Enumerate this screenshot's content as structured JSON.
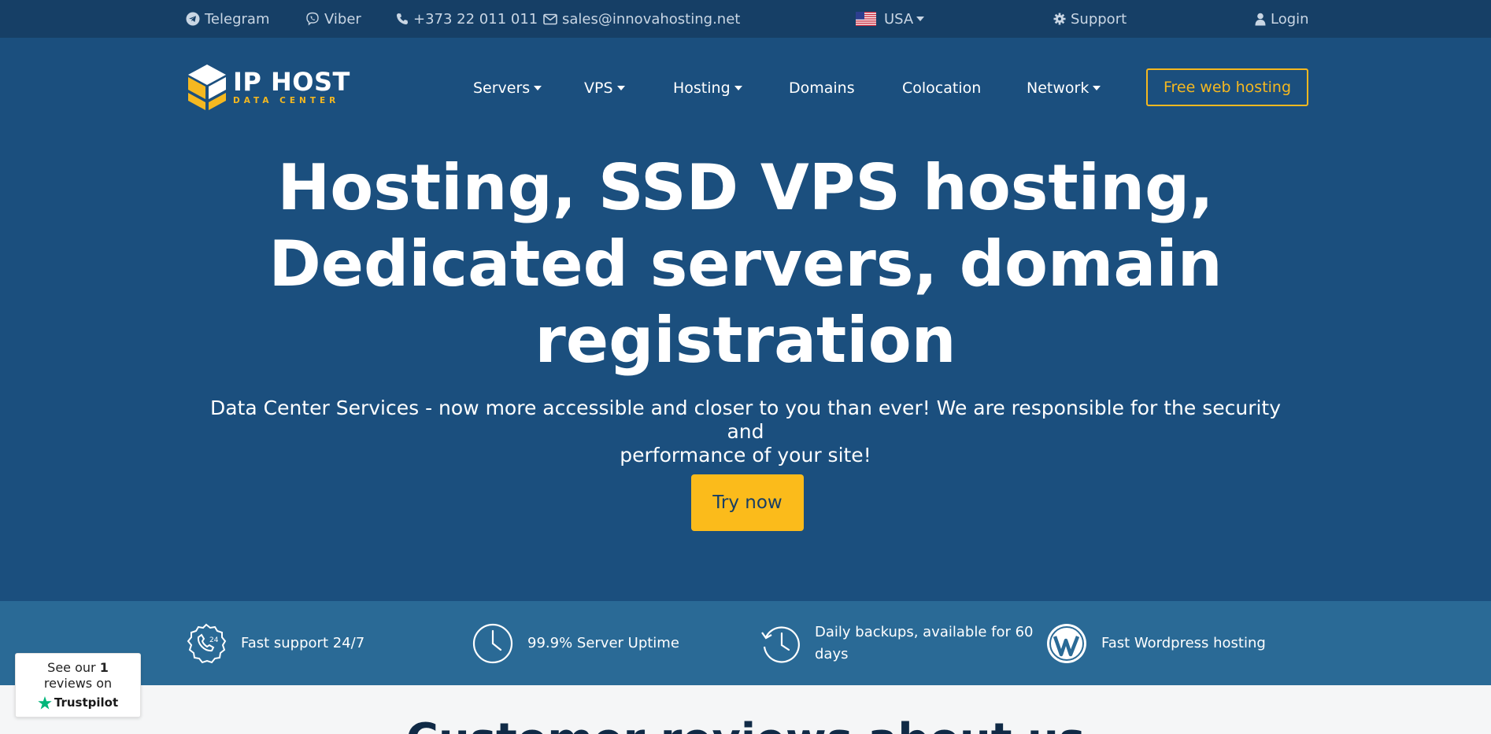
{
  "topbar": {
    "telegram": "Telegram",
    "viber": "Viber",
    "phone": "+373 22 011 011",
    "email": "sales@innovahosting.net",
    "country": "USA",
    "support": "Support",
    "login": "Login"
  },
  "logo": {
    "title": "IP HOST",
    "subtitle": "DATA CENTER"
  },
  "nav": {
    "servers": "Servers",
    "vps": "VPS",
    "hosting": "Hosting",
    "domains": "Domains",
    "colocation": "Colocation",
    "network": "Network",
    "cta": "Free web hosting"
  },
  "hero": {
    "title_line1": "Hosting, SSD VPS hosting,",
    "title_line2": "Dedicated servers, domain",
    "title_line3": "registration",
    "subtitle_line1": "Data Center Services - now more accessible and closer to you than ever! We are responsible for the security and",
    "subtitle_line2": "performance of your site!",
    "button": "Try now"
  },
  "features": [
    {
      "label": "Fast support 24/7",
      "icon": "support-24-icon"
    },
    {
      "label": "99.9% Server Uptime",
      "icon": "clock-icon"
    },
    {
      "label_line1": "Daily backups, available for 60",
      "label_line2": "days",
      "icon": "history-icon"
    },
    {
      "label": "Fast Wordpress hosting",
      "icon": "wordpress-icon"
    }
  ],
  "reviews": {
    "title": "Customer reviews about us"
  },
  "trustpilot": {
    "see_our": "See our",
    "count": "1",
    "reviews_on": "reviews on",
    "brand": "Trustpilot"
  },
  "colors": {
    "topbar_bg": "#163f66",
    "hero_bg": "#1b4f7e",
    "features_bg": "#2a6a96",
    "accent": "#fbbb1b",
    "trustpilot_green": "#00b67a"
  }
}
